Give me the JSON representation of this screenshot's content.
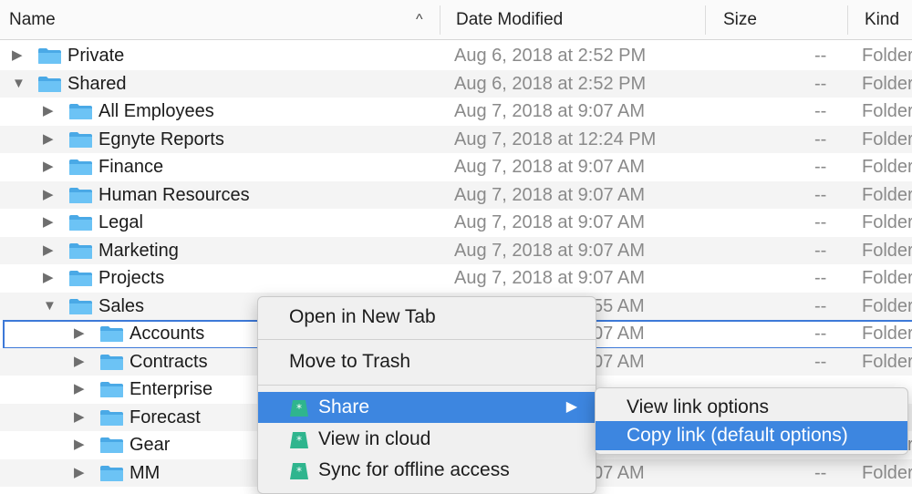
{
  "colors": {
    "folder": "#6cc3f5",
    "folder_dark": "#4aa9e6",
    "selection_border": "#3d79d8",
    "menu_highlight": "#3d86e0",
    "app_icon": "#2fb58e"
  },
  "columns": {
    "name": "Name",
    "date": "Date Modified",
    "size": "Size",
    "kind": "Kind"
  },
  "rows": [
    {
      "name": "Private",
      "date": "Aug 6, 2018 at 2:52 PM",
      "size": "--",
      "kind": "Folder",
      "expanded": false,
      "level": 0
    },
    {
      "name": "Shared",
      "date": "Aug 6, 2018 at 2:52 PM",
      "size": "--",
      "kind": "Folder",
      "expanded": true,
      "level": 0
    },
    {
      "name": "All Employees",
      "date": "Aug 7, 2018 at 9:07 AM",
      "size": "--",
      "kind": "Folder",
      "expanded": false,
      "level": 1
    },
    {
      "name": "Egnyte Reports",
      "date": "Aug 7, 2018 at 12:24 PM",
      "size": "--",
      "kind": "Folder",
      "expanded": false,
      "level": 1
    },
    {
      "name": "Finance",
      "date": "Aug 7, 2018 at 9:07 AM",
      "size": "--",
      "kind": "Folder",
      "expanded": false,
      "level": 1
    },
    {
      "name": "Human Resources",
      "date": "Aug 7, 2018 at 9:07 AM",
      "size": "--",
      "kind": "Folder",
      "expanded": false,
      "level": 1
    },
    {
      "name": "Legal",
      "date": "Aug 7, 2018 at 9:07 AM",
      "size": "--",
      "kind": "Folder",
      "expanded": false,
      "level": 1
    },
    {
      "name": "Marketing",
      "date": "Aug 7, 2018 at 9:07 AM",
      "size": "--",
      "kind": "Folder",
      "expanded": false,
      "level": 1
    },
    {
      "name": "Projects",
      "date": "Aug 7, 2018 at 9:07 AM",
      "size": "--",
      "kind": "Folder",
      "expanded": false,
      "level": 1
    },
    {
      "name": "Sales",
      "date": "55 AM",
      "size": "--",
      "kind": "Folder",
      "expanded": true,
      "level": 1
    },
    {
      "name": "Accounts",
      "date": "07 AM",
      "size": "--",
      "kind": "Folder",
      "expanded": false,
      "level": 2,
      "selected": true
    },
    {
      "name": "Contracts",
      "date": "07 AM",
      "size": "--",
      "kind": "Folder",
      "expanded": false,
      "level": 2
    },
    {
      "name": "Enterprise",
      "date": "",
      "size": "--",
      "kind": "",
      "expanded": false,
      "level": 2
    },
    {
      "name": "Forecast",
      "date": "",
      "size": "",
      "kind": "",
      "expanded": false,
      "level": 2
    },
    {
      "name": "Gear",
      "date": "",
      "size": "--",
      "kind": "Folder",
      "expanded": false,
      "level": 2
    },
    {
      "name": "MM",
      "date": "07 AM",
      "size": "--",
      "kind": "Folder",
      "expanded": false,
      "level": 2
    }
  ],
  "context_menu": {
    "items": [
      {
        "label": "Open in New Tab"
      },
      {
        "label": "Move to Trash"
      },
      {
        "label": "Share",
        "icon": "egnyte-icon",
        "submenu": true
      },
      {
        "label": "View in cloud",
        "icon": "egnyte-icon"
      },
      {
        "label": "Sync for offline access",
        "icon": "egnyte-icon"
      }
    ],
    "share_submenu": [
      {
        "label": "View link options"
      },
      {
        "label": "Copy link (default options)"
      }
    ]
  }
}
